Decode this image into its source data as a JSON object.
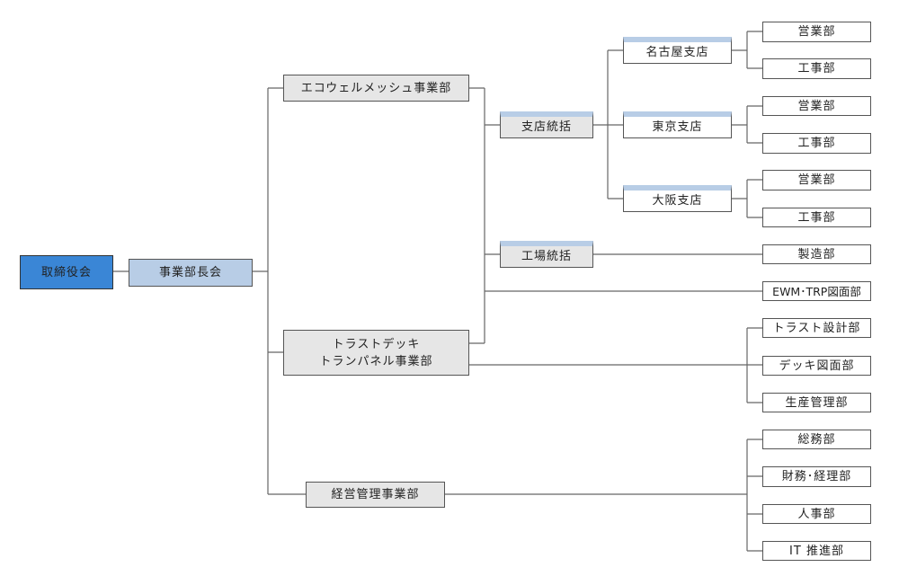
{
  "colors": {
    "board": "#3a86d6",
    "council": "#b8cde6",
    "division": "#e6e6e6",
    "band": "#b8cde6",
    "line": "#666666"
  },
  "board": "取締役会",
  "council": "事業部長会",
  "divisions": {
    "ecowell": "エコウェルメッシュ事業部",
    "trust_line1": "トラストデッキ",
    "trust_line2": "トランパネル事業部",
    "management": "経営管理事業部"
  },
  "ecowell": {
    "branch_hq": "支店統括",
    "factory_hq": "工場統括",
    "branches": [
      {
        "name": "名古屋支店",
        "depts": [
          "営業部",
          "工事部"
        ]
      },
      {
        "name": "東京支店",
        "depts": [
          "営業部",
          "工事部"
        ]
      },
      {
        "name": "大阪支店",
        "depts": [
          "営業部",
          "工事部"
        ]
      }
    ],
    "factory_dept": "製造部",
    "drawing_dept": "EWM･TRP図面部"
  },
  "trust_depts": [
    "トラスト設計部",
    "デッキ図面部",
    "生産管理部"
  ],
  "management_depts": [
    "総務部",
    "財務･経理部",
    "人事部",
    "IT 推進部"
  ]
}
